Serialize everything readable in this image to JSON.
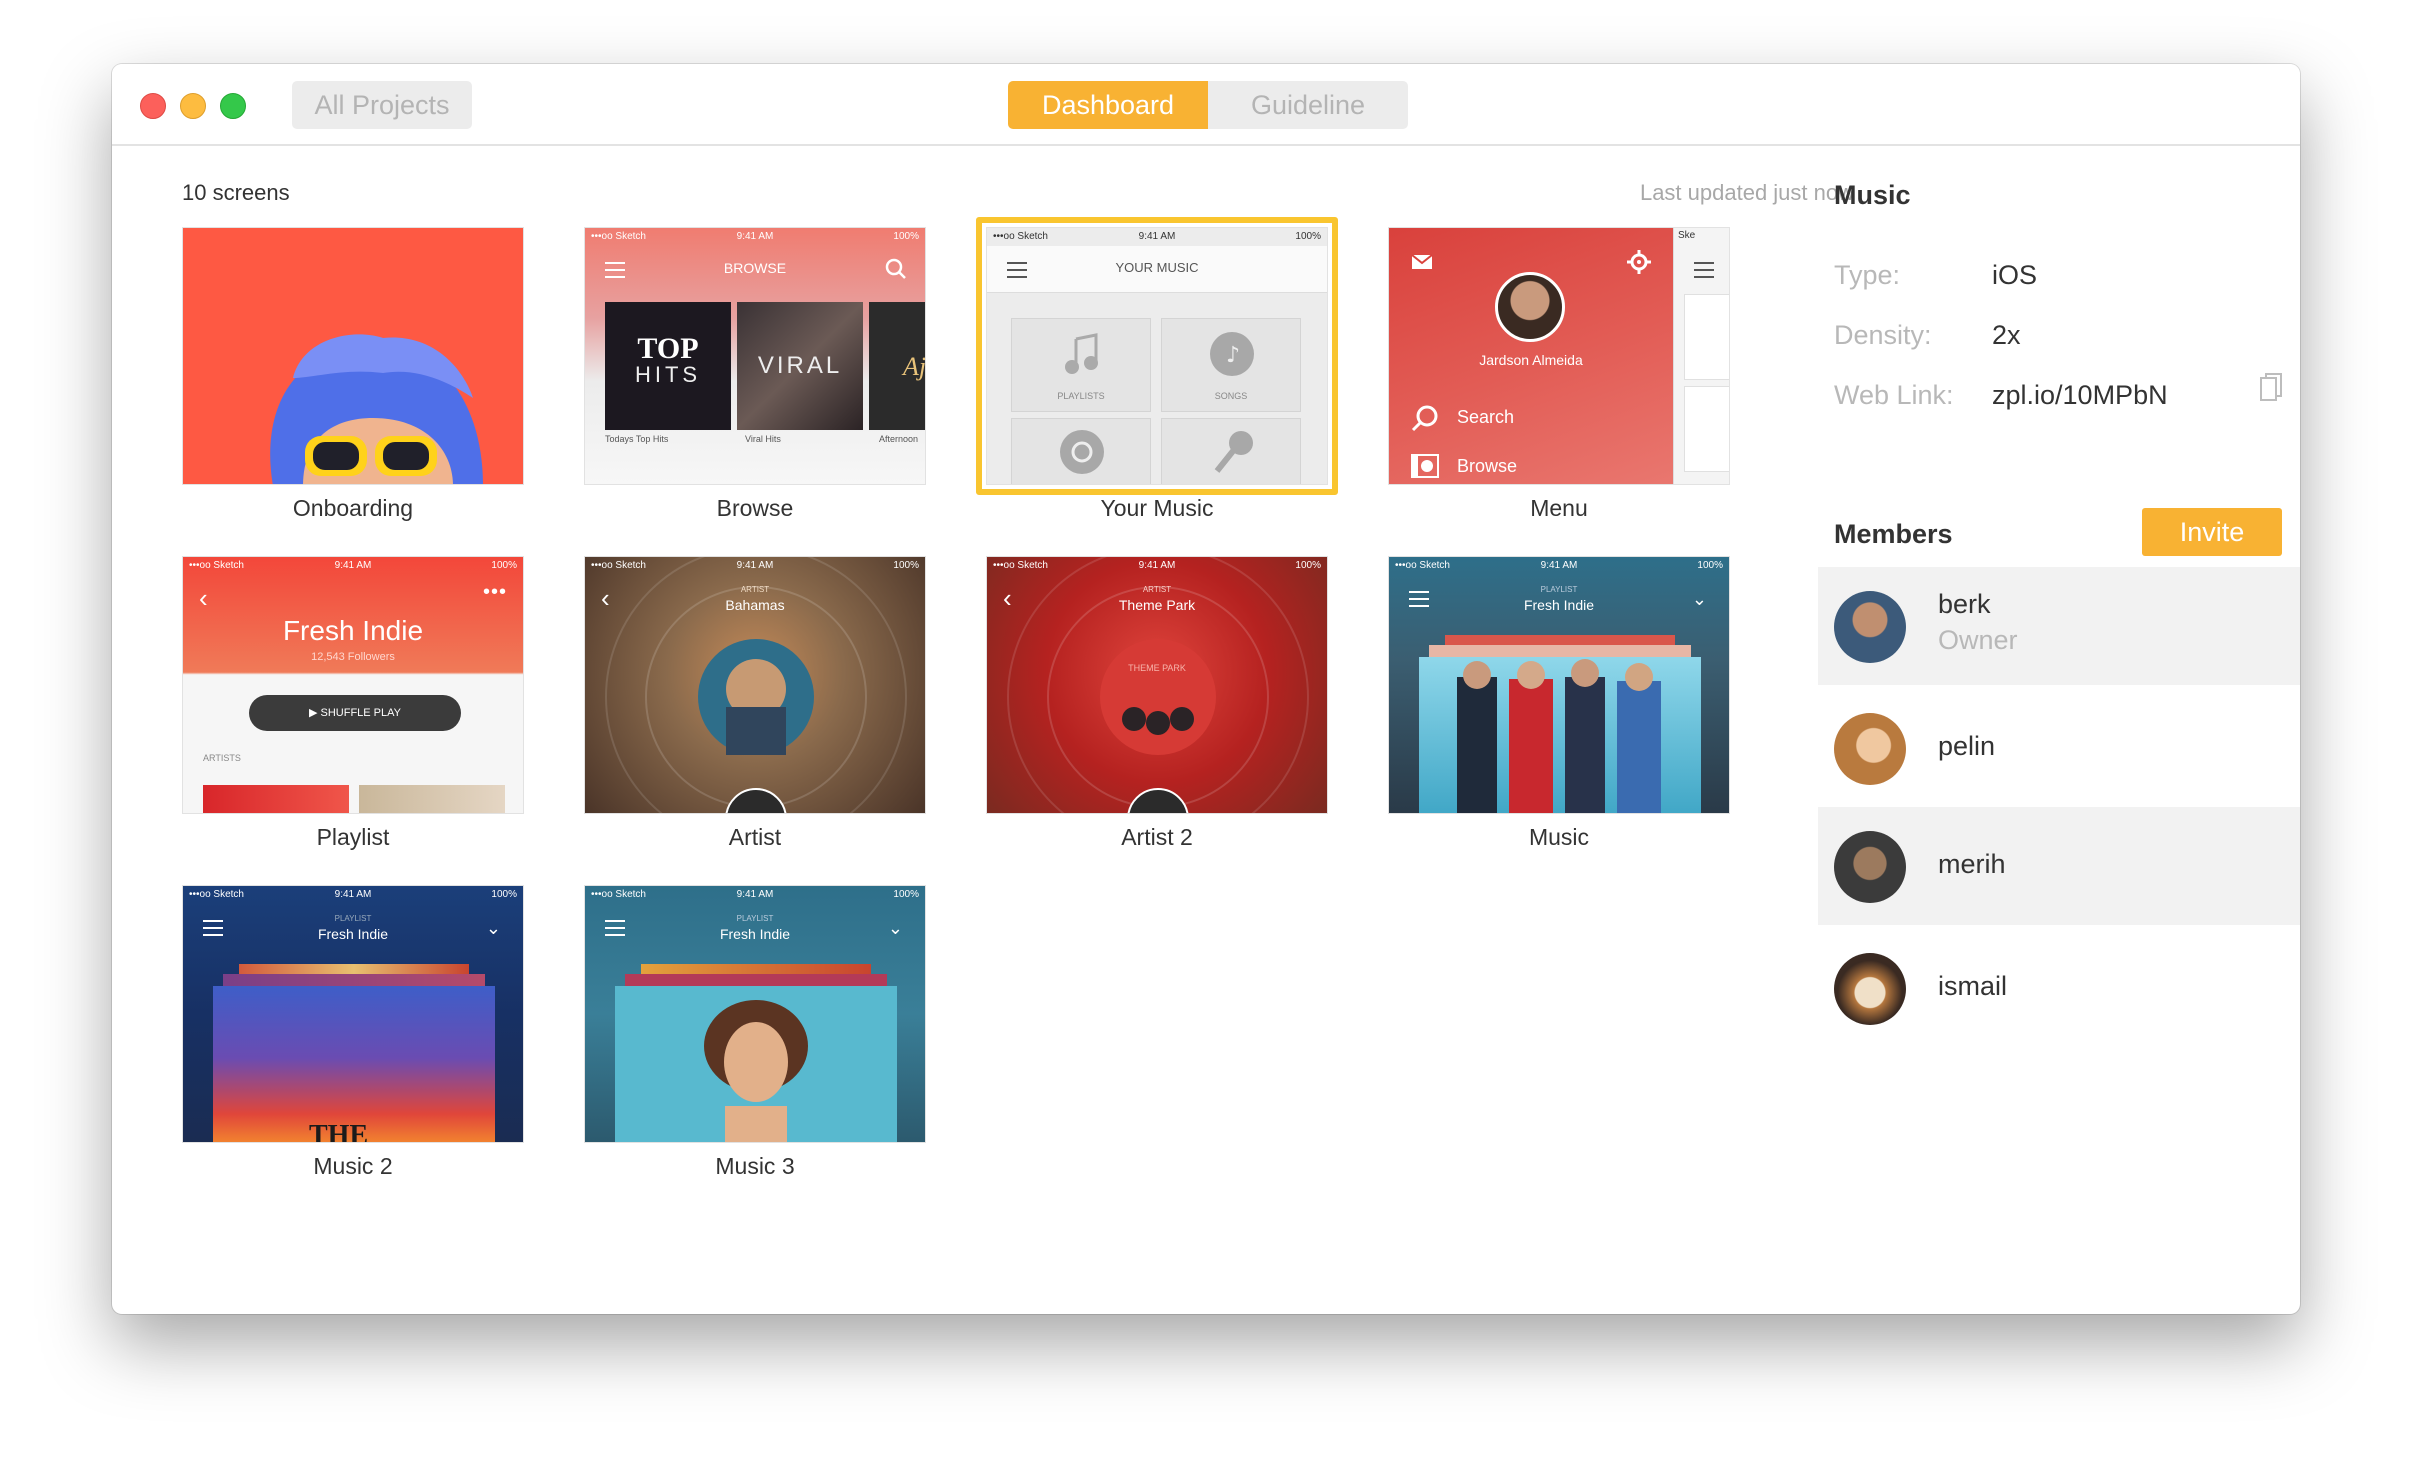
{
  "toolbar": {
    "all_projects": "All Projects",
    "tabs": [
      {
        "label": "Dashboard",
        "active": true
      },
      {
        "label": "Guideline",
        "active": false
      }
    ]
  },
  "main": {
    "screens_count": "10 screens",
    "last_updated": "Last updated just now",
    "screens": [
      {
        "name": "Onboarding"
      },
      {
        "name": "Browse",
        "header": "BROWSE",
        "tiles": [
          "TOP",
          "HITS",
          "VIRAL",
          "Aj"
        ],
        "tile_captions": [
          "Todays Top Hits",
          "Viral Hits",
          "Afternoon"
        ]
      },
      {
        "name": "Your Music",
        "header": "YOUR MUSIC",
        "items": [
          "PLAYLISTS",
          "SONGS"
        ],
        "selected": true
      },
      {
        "name": "Menu",
        "user": "Jardson Almeida",
        "items": [
          "Search",
          "Browse"
        ],
        "status_cut": "Ske"
      },
      {
        "name": "Playlist",
        "title": "Fresh Indie",
        "followers": "12,543 Followers",
        "button": "SHUFFLE PLAY",
        "section": "ARTISTS"
      },
      {
        "name": "Artist",
        "kicker": "ARTIST",
        "title": "Bahamas"
      },
      {
        "name": "Artist 2",
        "kicker": "ARTIST",
        "title": "Theme Park",
        "disc_label": "THEME PARK"
      },
      {
        "name": "Music",
        "kicker": "PLAYLIST",
        "title": "Fresh Indie"
      },
      {
        "name": "Music 2",
        "kicker": "PLAYLIST",
        "title": "Fresh Indie",
        "cover_text": "THE"
      },
      {
        "name": "Music 3",
        "kicker": "PLAYLIST",
        "title": "Fresh Indie"
      }
    ],
    "status_bar": {
      "carrier": "•••oo Sketch",
      "time": "9:41 AM",
      "battery": "100%"
    }
  },
  "project": {
    "title": "Music",
    "type_label": "Type:",
    "type_value": "iOS",
    "density_label": "Density:",
    "density_value": "2x",
    "link_label": "Web Link:",
    "link_value": "zpl.io/10MPbN"
  },
  "members": {
    "title": "Members",
    "invite": "Invite",
    "list": [
      {
        "name": "berk",
        "role": "Owner"
      },
      {
        "name": "pelin",
        "role": ""
      },
      {
        "name": "merih",
        "role": ""
      },
      {
        "name": "ismail",
        "role": ""
      }
    ]
  },
  "colors": {
    "accent": "#f8b233",
    "selection": "#f9c52f"
  }
}
